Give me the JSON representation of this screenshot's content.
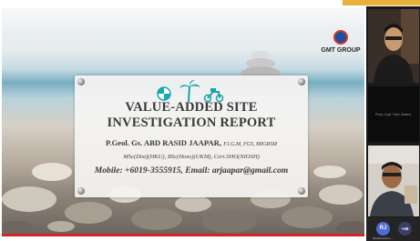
{
  "slide": {
    "logo_text": "GMT GROUP",
    "title_line1": "VALUE-ADDED SITE",
    "title_line2": "INVESTIGATION REPORT",
    "author_name": "P.Geol. Gs. ABD RASID JAAPAR,",
    "author_postnominals": "F.I.G.M, FGS, MIGRSM",
    "qualifications": "MSc(Dist)(HKU), BSc(Hons)(UKM), Cert.SHO(NIOSH)",
    "contact": "Mobile: +6019-3555915, Email: arjaapar@gmail.com"
  },
  "participants": {
    "tile2_name": "Pinoy. Lloyd. Yalve. Matena.",
    "bottom_avatar_initials": "RJ",
    "bottom_avatar_label": "Rasdimetrrkun...",
    "overflow_count": "+46"
  },
  "colors": {
    "accent_top": "#e8b13a",
    "slide_border": "#d4242a",
    "title_text": "#3a3a3a",
    "avatar": "#4f6bd8"
  },
  "icons": [
    "beach-ball-icon",
    "palm-tree-icon",
    "scooter-icon",
    "logo-icon"
  ]
}
